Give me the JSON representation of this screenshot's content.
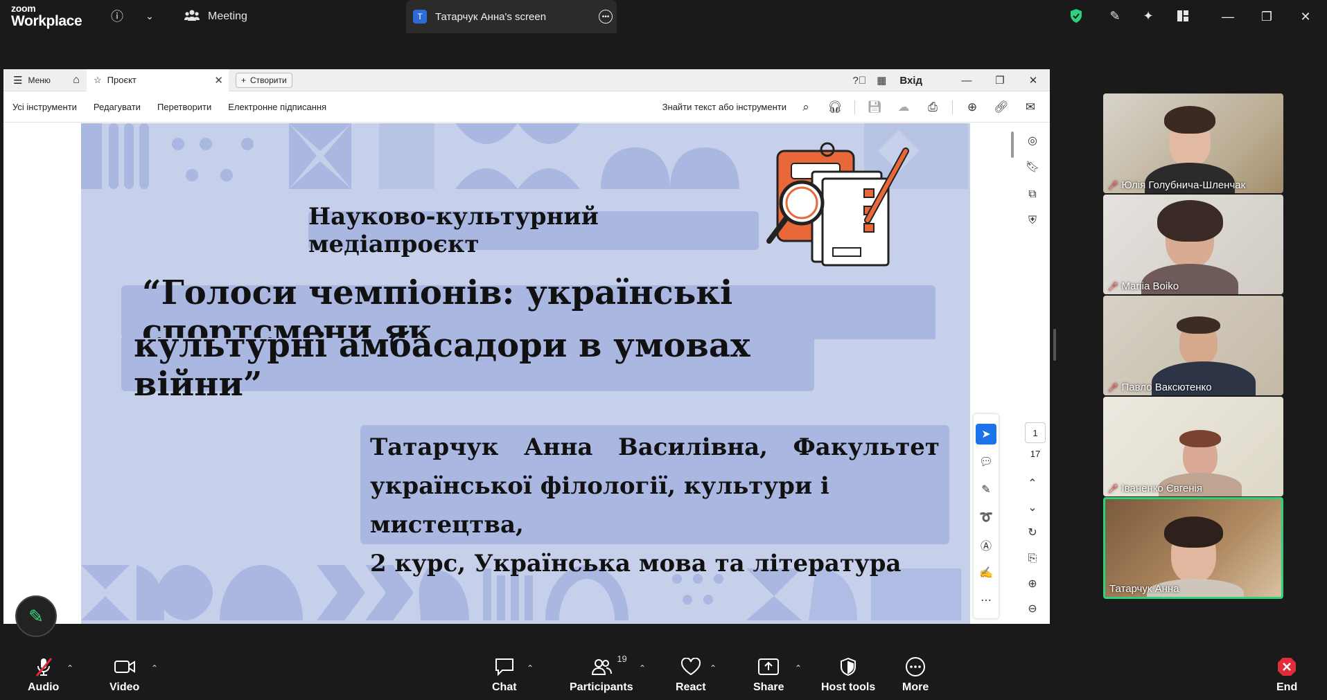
{
  "zoom": {
    "brand_top": "zoom",
    "brand_bottom": "Workplace",
    "meeting_tab": "Meeting",
    "share_tab_badge": "T",
    "share_tab": "Татарчук Анна's screen"
  },
  "acrobat": {
    "menu_label": "Меню",
    "doc_tab": "Проєкт",
    "create_label": "Створити",
    "signin_label": "Вхід",
    "tools": [
      "Усі інструменти",
      "Редагувати",
      "Перетворити",
      "Електронне підписання"
    ],
    "search_label": "Знайти текст або інструменти",
    "page_current": "1",
    "page_total": "17"
  },
  "slide": {
    "subtitle": "Науково-культурний медіапроєкт",
    "title_line1": "“Голоси чемпіонів: українські спортсмени як",
    "title_line2": "культурні амбасадори в умовах війни”",
    "author_words": [
      "Татарчук",
      "Анна",
      "Василівна,",
      "Факультет"
    ],
    "author_line2": "української філології, культури і мистецтва,",
    "author_line3": "2 курс, Українська мова та література"
  },
  "participants": [
    {
      "name": "Юлія Голубнича-Шленчак",
      "muted": true
    },
    {
      "name": "Mariia Boiko",
      "muted": true
    },
    {
      "name": "Павло Ваксютенко",
      "muted": true
    },
    {
      "name": "Іваненко Євгенія",
      "muted": true
    },
    {
      "name": "Татарчук Анна",
      "muted": false
    }
  ],
  "controls": {
    "audio": "Audio",
    "video": "Video",
    "chat": "Chat",
    "participants": "Participants",
    "participants_count": "19",
    "react": "React",
    "share": "Share",
    "host_tools": "Host tools",
    "more": "More",
    "end": "End"
  },
  "colors": {
    "slide_bg": "#c6d0ea",
    "slide_box": "#a9b7e1",
    "active_speaker": "#2bd47a",
    "end_red": "#e02d3c"
  }
}
